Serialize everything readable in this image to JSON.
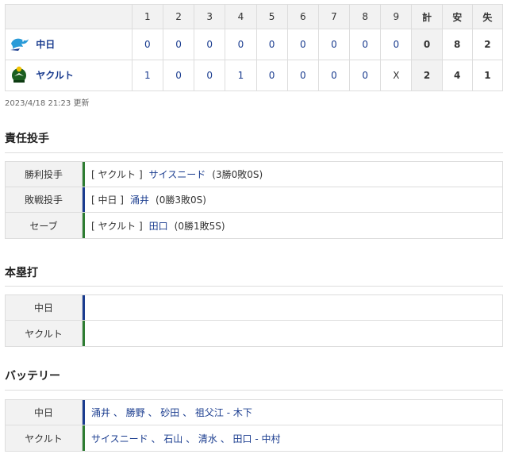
{
  "scoreboard": {
    "innings": [
      "1",
      "2",
      "3",
      "4",
      "5",
      "6",
      "7",
      "8",
      "9"
    ],
    "total_headers": [
      "計",
      "安",
      "失"
    ],
    "teams": [
      {
        "name": "中日",
        "runs": [
          "0",
          "0",
          "0",
          "0",
          "0",
          "0",
          "0",
          "0",
          "0"
        ],
        "r": "0",
        "h": "8",
        "e": "2",
        "logo": "dragons-logo"
      },
      {
        "name": "ヤクルト",
        "runs": [
          "1",
          "0",
          "0",
          "1",
          "0",
          "0",
          "0",
          "0",
          "X"
        ],
        "r": "2",
        "h": "4",
        "e": "1",
        "logo": "swallows-logo"
      }
    ]
  },
  "updated": "2023/4/18 21:23 更新",
  "responsible": {
    "title": "責任投手",
    "rows": [
      {
        "label": "勝利投手",
        "team": "[ ヤクルト ]",
        "player": "サイスニード",
        "record": "(3勝0敗0S)"
      },
      {
        "label": "敗戦投手",
        "team": "[ 中日 ]",
        "player": "涌井",
        "record": "(0勝3敗0S)"
      },
      {
        "label": "セーブ",
        "team": "[ ヤクルト ]",
        "player": "田口",
        "record": "(0勝1敗5S)"
      }
    ]
  },
  "homeruns": {
    "title": "本塁打",
    "rows": [
      {
        "label": "中日",
        "value": ""
      },
      {
        "label": "ヤクルト",
        "value": ""
      }
    ]
  },
  "battery": {
    "title": "バッテリー",
    "rows": [
      {
        "label": "中日",
        "value": "涌井 、 勝野 、 砂田 、 祖父江 - 木下"
      },
      {
        "label": "ヤクルト",
        "value": "サイスニード 、 石山 、 清水 、 田口 - 中村"
      }
    ]
  },
  "colors": {
    "dragons": "#1a3c8f",
    "swallows": "#2e7d32",
    "link": "#1a3c8f"
  }
}
